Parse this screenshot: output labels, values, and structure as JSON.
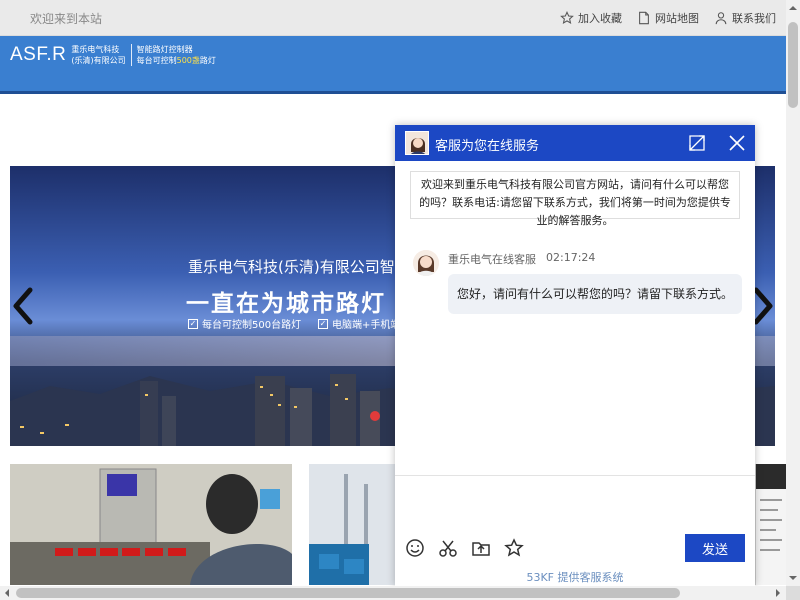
{
  "topbar": {
    "welcome": "欢迎来到本站",
    "links": [
      {
        "icon": "star-icon",
        "label": "加入收藏"
      },
      {
        "icon": "document-icon",
        "label": "网站地图"
      },
      {
        "icon": "user-icon",
        "label": "联系我们"
      }
    ]
  },
  "header": {
    "logo_mark": "ASF.R",
    "company_line1": "重乐电气科技",
    "company_line2": "(乐清)有限公司",
    "tagline_line1": "智能路灯控制器",
    "tagline_line2_pre": "每台可控制",
    "tagline_line2_hl": "500盏",
    "tagline_line2_post": "路灯"
  },
  "banner": {
    "company": "重乐电气科技(乐清)有限公司智",
    "slogan": "一直在为城市路灯",
    "feature1": "每台可控制500台路灯",
    "feature2": "电脑端+手机端"
  },
  "chat": {
    "title": "客服为您在线服务",
    "notice": "欢迎来到重乐电气科技有限公司官方网站，请问有什么可以帮您的吗？联系电话:请您留下联系方式，我们将第一时间为您提供专业的解答服务。",
    "agent_name": "重乐电气在线客服",
    "time": "02:17:24",
    "message": "您好，请问有什么可以帮您的吗？请留下联系方式。",
    "send_label": "发送",
    "powered_by": "53KF 提供客服系统",
    "header_color": "#1c48c4"
  }
}
